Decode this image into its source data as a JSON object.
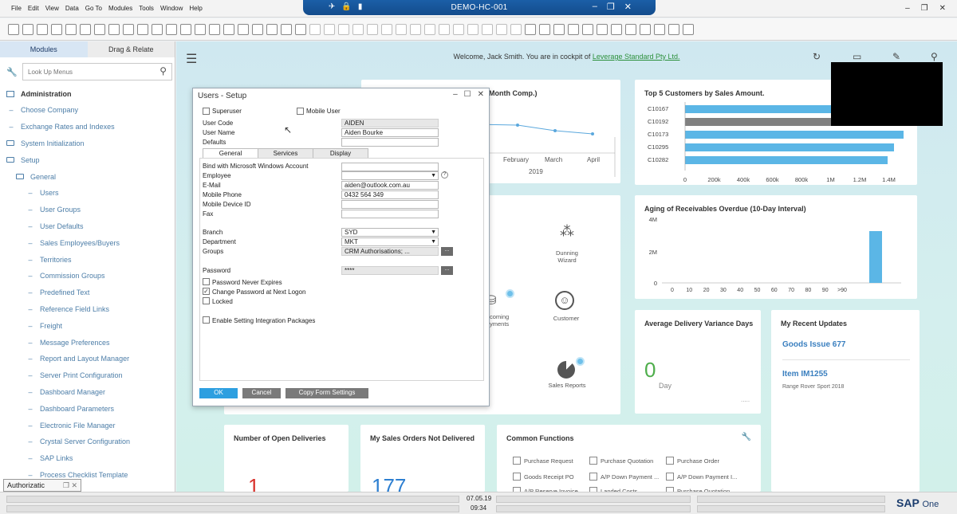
{
  "window": {
    "title": "DEMO-HC-001",
    "menus": [
      "File",
      "Edit",
      "View",
      "Data",
      "Go To",
      "Modules",
      "Tools",
      "Window",
      "Help"
    ]
  },
  "sidebar": {
    "tabs": [
      "Modules",
      "Drag & Relate"
    ],
    "search_placeholder": "Look Up Menus",
    "section": "Administration",
    "items": [
      {
        "label": "Choose Company",
        "indent": 1,
        "kind": "leaf"
      },
      {
        "label": "Exchange Rates and Indexes",
        "indent": 1,
        "kind": "leaf"
      },
      {
        "label": "System Initialization",
        "indent": 1,
        "kind": "folder"
      },
      {
        "label": "Setup",
        "indent": 1,
        "kind": "folder"
      },
      {
        "label": "General",
        "indent": 2,
        "kind": "folder"
      },
      {
        "label": "Users",
        "indent": 3,
        "kind": "leaf"
      },
      {
        "label": "User Groups",
        "indent": 3,
        "kind": "leaf"
      },
      {
        "label": "User Defaults",
        "indent": 3,
        "kind": "leaf"
      },
      {
        "label": "Sales Employees/Buyers",
        "indent": 3,
        "kind": "leaf"
      },
      {
        "label": "Territories",
        "indent": 3,
        "kind": "leaf"
      },
      {
        "label": "Commission Groups",
        "indent": 3,
        "kind": "leaf"
      },
      {
        "label": "Predefined Text",
        "indent": 3,
        "kind": "leaf"
      },
      {
        "label": "Reference Field Links",
        "indent": 3,
        "kind": "leaf"
      },
      {
        "label": "Freight",
        "indent": 3,
        "kind": "leaf"
      },
      {
        "label": "Message Preferences",
        "indent": 3,
        "kind": "leaf"
      },
      {
        "label": "Report and Layout Manager",
        "indent": 3,
        "kind": "leaf"
      },
      {
        "label": "Server Print Configuration",
        "indent": 3,
        "kind": "leaf"
      },
      {
        "label": "Dashboard Manager",
        "indent": 3,
        "kind": "leaf"
      },
      {
        "label": "Dashboard Parameters",
        "indent": 3,
        "kind": "leaf"
      },
      {
        "label": "Electronic File Manager",
        "indent": 3,
        "kind": "leaf"
      },
      {
        "label": "Crystal Server Configuration",
        "indent": 3,
        "kind": "leaf"
      },
      {
        "label": "SAP Links",
        "indent": 3,
        "kind": "leaf"
      },
      {
        "label": "Process Checklist Template",
        "indent": 3,
        "kind": "leaf"
      }
    ],
    "bottom_tab": "Authorizatic"
  },
  "cockpit": {
    "welcome_prefix": "Welcome, Jack Smith. You are in cockpit of ",
    "company": "Leverage Standard Pty Ltd.",
    "sales_card": {
      "title_fragment": "Month Comp.)",
      "months": [
        "y",
        "February",
        "March",
        "April"
      ],
      "year": "2019"
    },
    "top5": {
      "title": "Top 5 Customers by Sales Amount.",
      "customers": [
        "C10167",
        "C10192",
        "C10173",
        "C10295",
        "C10282"
      ],
      "axis": [
        "0",
        "200k",
        "400k",
        "600k",
        "800k",
        "1M",
        "1.2M",
        "1.4M"
      ]
    },
    "aging": {
      "title": "Aging of Receivables Overdue (10-Day Interval)",
      "y_ticks": [
        "4M",
        "2M",
        "0"
      ],
      "x_ticks": [
        "0",
        "10",
        "20",
        "30",
        "40",
        "50",
        "60",
        "70",
        "80",
        "90",
        ">90"
      ]
    },
    "shortcuts": {
      "dunning": "Dunning Wizard",
      "customer": "Customer",
      "incoming": "coming yments",
      "sales_reports": "Sales Reports"
    },
    "avg_delivery": {
      "title": "Average Delivery Variance Days",
      "value": "0",
      "unit": "Day",
      "more": "....."
    },
    "recent": {
      "title": "My Recent Updates",
      "items": [
        {
          "label": "Goods Issue 677",
          "sub": ""
        },
        {
          "label": "Item IM1255",
          "sub": "Range Rover Sport 2018"
        }
      ]
    },
    "open_deliveries": {
      "title": "Number of Open Deliveries",
      "value": "1"
    },
    "sales_orders": {
      "title": "My Sales Orders Not Delivered",
      "value": "177"
    },
    "common": {
      "title": "Common Functions",
      "items": [
        "Purchase Request",
        "Purchase Quotation",
        "Purchase Order",
        "Goods Receipt PO",
        "A/P Down Payment ...",
        "A/P Down Payment I...",
        "A/P Reserve Invoice",
        "Landed Costs",
        "Purchase Quotation"
      ]
    }
  },
  "dialog": {
    "title": "Users - Setup",
    "superuser": "Superuser",
    "mobile_user": "Mobile User",
    "user_code_label": "User Code",
    "user_code": "AIDEN",
    "user_name_label": "User Name",
    "user_name": "Aiden Bourke",
    "defaults_label": "Defaults",
    "tabs": [
      "General",
      "Services",
      "Display"
    ],
    "bind_label": "Bind with Microsoft Windows Account",
    "employee_label": "Employee",
    "email_label": "E-Mail",
    "email": "aiden@outlook.com.au",
    "mobile_label": "Mobile Phone",
    "mobile": "0432 564 349",
    "device_label": "Mobile Device ID",
    "fax_label": "Fax",
    "branch_label": "Branch",
    "branch": "SYD",
    "department_label": "Department",
    "department": "MKT",
    "groups_label": "Groups",
    "groups": "CRM Authorisations; ...",
    "password_label": "Password",
    "password": "****",
    "pw_never_expires": "Password Never Expires",
    "change_pw": "Change Password at Next Logon",
    "locked": "Locked",
    "integration": "Enable Setting Integration Packages",
    "ok": "OK",
    "cancel": "Cancel",
    "copy": "Copy Form Settings"
  },
  "status": {
    "date": "07.05.19",
    "time": "09:34",
    "logo": "SAP",
    "logo_sub": "One"
  }
}
